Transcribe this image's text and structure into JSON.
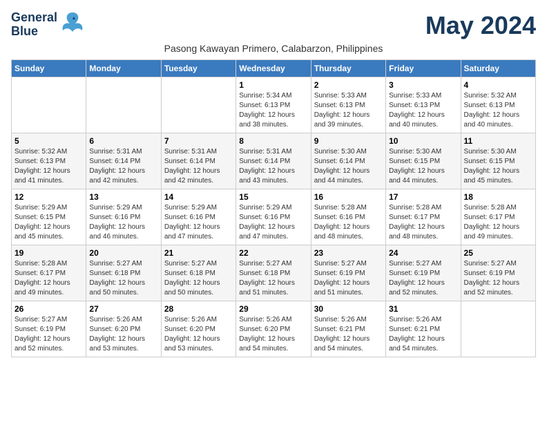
{
  "logo": {
    "line1": "General",
    "line2": "Blue"
  },
  "title": "May 2024",
  "subtitle": "Pasong Kawayan Primero, Calabarzon, Philippines",
  "weekdays": [
    "Sunday",
    "Monday",
    "Tuesday",
    "Wednesday",
    "Thursday",
    "Friday",
    "Saturday"
  ],
  "weeks": [
    [
      {
        "day": "",
        "info": ""
      },
      {
        "day": "",
        "info": ""
      },
      {
        "day": "",
        "info": ""
      },
      {
        "day": "1",
        "info": "Sunrise: 5:34 AM\nSunset: 6:13 PM\nDaylight: 12 hours\nand 38 minutes."
      },
      {
        "day": "2",
        "info": "Sunrise: 5:33 AM\nSunset: 6:13 PM\nDaylight: 12 hours\nand 39 minutes."
      },
      {
        "day": "3",
        "info": "Sunrise: 5:33 AM\nSunset: 6:13 PM\nDaylight: 12 hours\nand 40 minutes."
      },
      {
        "day": "4",
        "info": "Sunrise: 5:32 AM\nSunset: 6:13 PM\nDaylight: 12 hours\nand 40 minutes."
      }
    ],
    [
      {
        "day": "5",
        "info": "Sunrise: 5:32 AM\nSunset: 6:13 PM\nDaylight: 12 hours\nand 41 minutes."
      },
      {
        "day": "6",
        "info": "Sunrise: 5:31 AM\nSunset: 6:14 PM\nDaylight: 12 hours\nand 42 minutes."
      },
      {
        "day": "7",
        "info": "Sunrise: 5:31 AM\nSunset: 6:14 PM\nDaylight: 12 hours\nand 42 minutes."
      },
      {
        "day": "8",
        "info": "Sunrise: 5:31 AM\nSunset: 6:14 PM\nDaylight: 12 hours\nand 43 minutes."
      },
      {
        "day": "9",
        "info": "Sunrise: 5:30 AM\nSunset: 6:14 PM\nDaylight: 12 hours\nand 44 minutes."
      },
      {
        "day": "10",
        "info": "Sunrise: 5:30 AM\nSunset: 6:15 PM\nDaylight: 12 hours\nand 44 minutes."
      },
      {
        "day": "11",
        "info": "Sunrise: 5:30 AM\nSunset: 6:15 PM\nDaylight: 12 hours\nand 45 minutes."
      }
    ],
    [
      {
        "day": "12",
        "info": "Sunrise: 5:29 AM\nSunset: 6:15 PM\nDaylight: 12 hours\nand 45 minutes."
      },
      {
        "day": "13",
        "info": "Sunrise: 5:29 AM\nSunset: 6:16 PM\nDaylight: 12 hours\nand 46 minutes."
      },
      {
        "day": "14",
        "info": "Sunrise: 5:29 AM\nSunset: 6:16 PM\nDaylight: 12 hours\nand 47 minutes."
      },
      {
        "day": "15",
        "info": "Sunrise: 5:29 AM\nSunset: 6:16 PM\nDaylight: 12 hours\nand 47 minutes."
      },
      {
        "day": "16",
        "info": "Sunrise: 5:28 AM\nSunset: 6:16 PM\nDaylight: 12 hours\nand 48 minutes."
      },
      {
        "day": "17",
        "info": "Sunrise: 5:28 AM\nSunset: 6:17 PM\nDaylight: 12 hours\nand 48 minutes."
      },
      {
        "day": "18",
        "info": "Sunrise: 5:28 AM\nSunset: 6:17 PM\nDaylight: 12 hours\nand 49 minutes."
      }
    ],
    [
      {
        "day": "19",
        "info": "Sunrise: 5:28 AM\nSunset: 6:17 PM\nDaylight: 12 hours\nand 49 minutes."
      },
      {
        "day": "20",
        "info": "Sunrise: 5:27 AM\nSunset: 6:18 PM\nDaylight: 12 hours\nand 50 minutes."
      },
      {
        "day": "21",
        "info": "Sunrise: 5:27 AM\nSunset: 6:18 PM\nDaylight: 12 hours\nand 50 minutes."
      },
      {
        "day": "22",
        "info": "Sunrise: 5:27 AM\nSunset: 6:18 PM\nDaylight: 12 hours\nand 51 minutes."
      },
      {
        "day": "23",
        "info": "Sunrise: 5:27 AM\nSunset: 6:19 PM\nDaylight: 12 hours\nand 51 minutes."
      },
      {
        "day": "24",
        "info": "Sunrise: 5:27 AM\nSunset: 6:19 PM\nDaylight: 12 hours\nand 52 minutes."
      },
      {
        "day": "25",
        "info": "Sunrise: 5:27 AM\nSunset: 6:19 PM\nDaylight: 12 hours\nand 52 minutes."
      }
    ],
    [
      {
        "day": "26",
        "info": "Sunrise: 5:27 AM\nSunset: 6:19 PM\nDaylight: 12 hours\nand 52 minutes."
      },
      {
        "day": "27",
        "info": "Sunrise: 5:26 AM\nSunset: 6:20 PM\nDaylight: 12 hours\nand 53 minutes."
      },
      {
        "day": "28",
        "info": "Sunrise: 5:26 AM\nSunset: 6:20 PM\nDaylight: 12 hours\nand 53 minutes."
      },
      {
        "day": "29",
        "info": "Sunrise: 5:26 AM\nSunset: 6:20 PM\nDaylight: 12 hours\nand 54 minutes."
      },
      {
        "day": "30",
        "info": "Sunrise: 5:26 AM\nSunset: 6:21 PM\nDaylight: 12 hours\nand 54 minutes."
      },
      {
        "day": "31",
        "info": "Sunrise: 5:26 AM\nSunset: 6:21 PM\nDaylight: 12 hours\nand 54 minutes."
      },
      {
        "day": "",
        "info": ""
      }
    ]
  ]
}
